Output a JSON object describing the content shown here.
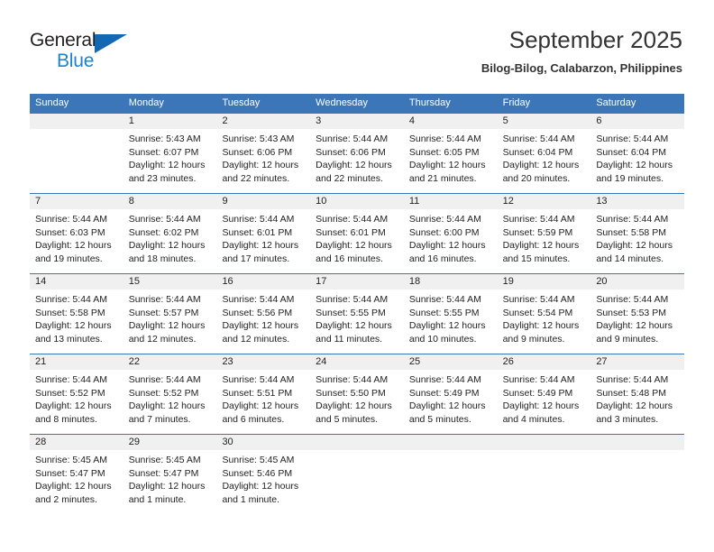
{
  "logo": {
    "word_one": "General",
    "word_two": "Blue",
    "triangle_color": "#1268b3",
    "blue_text_color": "#1c82d2"
  },
  "header": {
    "title": "September 2025",
    "subtitle": "Bilog-Bilog, Calabarzon, Philippines"
  },
  "theme": {
    "header_blue": "#3b76b8",
    "date_band": "#f0f0f0",
    "text": "#222222"
  },
  "weekdays": [
    "Sunday",
    "Monday",
    "Tuesday",
    "Wednesday",
    "Thursday",
    "Friday",
    "Saturday"
  ],
  "weeks": [
    [
      {
        "day": "",
        "sunrise": "",
        "sunset": "",
        "daylight_line1": "",
        "daylight_line2": ""
      },
      {
        "day": "1",
        "sunrise": "Sunrise: 5:43 AM",
        "sunset": "Sunset: 6:07 PM",
        "daylight_line1": "Daylight: 12 hours",
        "daylight_line2": "and 23 minutes."
      },
      {
        "day": "2",
        "sunrise": "Sunrise: 5:43 AM",
        "sunset": "Sunset: 6:06 PM",
        "daylight_line1": "Daylight: 12 hours",
        "daylight_line2": "and 22 minutes."
      },
      {
        "day": "3",
        "sunrise": "Sunrise: 5:44 AM",
        "sunset": "Sunset: 6:06 PM",
        "daylight_line1": "Daylight: 12 hours",
        "daylight_line2": "and 22 minutes."
      },
      {
        "day": "4",
        "sunrise": "Sunrise: 5:44 AM",
        "sunset": "Sunset: 6:05 PM",
        "daylight_line1": "Daylight: 12 hours",
        "daylight_line2": "and 21 minutes."
      },
      {
        "day": "5",
        "sunrise": "Sunrise: 5:44 AM",
        "sunset": "Sunset: 6:04 PM",
        "daylight_line1": "Daylight: 12 hours",
        "daylight_line2": "and 20 minutes."
      },
      {
        "day": "6",
        "sunrise": "Sunrise: 5:44 AM",
        "sunset": "Sunset: 6:04 PM",
        "daylight_line1": "Daylight: 12 hours",
        "daylight_line2": "and 19 minutes."
      }
    ],
    [
      {
        "day": "7",
        "sunrise": "Sunrise: 5:44 AM",
        "sunset": "Sunset: 6:03 PM",
        "daylight_line1": "Daylight: 12 hours",
        "daylight_line2": "and 19 minutes."
      },
      {
        "day": "8",
        "sunrise": "Sunrise: 5:44 AM",
        "sunset": "Sunset: 6:02 PM",
        "daylight_line1": "Daylight: 12 hours",
        "daylight_line2": "and 18 minutes."
      },
      {
        "day": "9",
        "sunrise": "Sunrise: 5:44 AM",
        "sunset": "Sunset: 6:01 PM",
        "daylight_line1": "Daylight: 12 hours",
        "daylight_line2": "and 17 minutes."
      },
      {
        "day": "10",
        "sunrise": "Sunrise: 5:44 AM",
        "sunset": "Sunset: 6:01 PM",
        "daylight_line1": "Daylight: 12 hours",
        "daylight_line2": "and 16 minutes."
      },
      {
        "day": "11",
        "sunrise": "Sunrise: 5:44 AM",
        "sunset": "Sunset: 6:00 PM",
        "daylight_line1": "Daylight: 12 hours",
        "daylight_line2": "and 16 minutes."
      },
      {
        "day": "12",
        "sunrise": "Sunrise: 5:44 AM",
        "sunset": "Sunset: 5:59 PM",
        "daylight_line1": "Daylight: 12 hours",
        "daylight_line2": "and 15 minutes."
      },
      {
        "day": "13",
        "sunrise": "Sunrise: 5:44 AM",
        "sunset": "Sunset: 5:58 PM",
        "daylight_line1": "Daylight: 12 hours",
        "daylight_line2": "and 14 minutes."
      }
    ],
    [
      {
        "day": "14",
        "sunrise": "Sunrise: 5:44 AM",
        "sunset": "Sunset: 5:58 PM",
        "daylight_line1": "Daylight: 12 hours",
        "daylight_line2": "and 13 minutes."
      },
      {
        "day": "15",
        "sunrise": "Sunrise: 5:44 AM",
        "sunset": "Sunset: 5:57 PM",
        "daylight_line1": "Daylight: 12 hours",
        "daylight_line2": "and 12 minutes."
      },
      {
        "day": "16",
        "sunrise": "Sunrise: 5:44 AM",
        "sunset": "Sunset: 5:56 PM",
        "daylight_line1": "Daylight: 12 hours",
        "daylight_line2": "and 12 minutes."
      },
      {
        "day": "17",
        "sunrise": "Sunrise: 5:44 AM",
        "sunset": "Sunset: 5:55 PM",
        "daylight_line1": "Daylight: 12 hours",
        "daylight_line2": "and 11 minutes."
      },
      {
        "day": "18",
        "sunrise": "Sunrise: 5:44 AM",
        "sunset": "Sunset: 5:55 PM",
        "daylight_line1": "Daylight: 12 hours",
        "daylight_line2": "and 10 minutes."
      },
      {
        "day": "19",
        "sunrise": "Sunrise: 5:44 AM",
        "sunset": "Sunset: 5:54 PM",
        "daylight_line1": "Daylight: 12 hours",
        "daylight_line2": "and 9 minutes."
      },
      {
        "day": "20",
        "sunrise": "Sunrise: 5:44 AM",
        "sunset": "Sunset: 5:53 PM",
        "daylight_line1": "Daylight: 12 hours",
        "daylight_line2": "and 9 minutes."
      }
    ],
    [
      {
        "day": "21",
        "sunrise": "Sunrise: 5:44 AM",
        "sunset": "Sunset: 5:52 PM",
        "daylight_line1": "Daylight: 12 hours",
        "daylight_line2": "and 8 minutes."
      },
      {
        "day": "22",
        "sunrise": "Sunrise: 5:44 AM",
        "sunset": "Sunset: 5:52 PM",
        "daylight_line1": "Daylight: 12 hours",
        "daylight_line2": "and 7 minutes."
      },
      {
        "day": "23",
        "sunrise": "Sunrise: 5:44 AM",
        "sunset": "Sunset: 5:51 PM",
        "daylight_line1": "Daylight: 12 hours",
        "daylight_line2": "and 6 minutes."
      },
      {
        "day": "24",
        "sunrise": "Sunrise: 5:44 AM",
        "sunset": "Sunset: 5:50 PM",
        "daylight_line1": "Daylight: 12 hours",
        "daylight_line2": "and 5 minutes."
      },
      {
        "day": "25",
        "sunrise": "Sunrise: 5:44 AM",
        "sunset": "Sunset: 5:49 PM",
        "daylight_line1": "Daylight: 12 hours",
        "daylight_line2": "and 5 minutes."
      },
      {
        "day": "26",
        "sunrise": "Sunrise: 5:44 AM",
        "sunset": "Sunset: 5:49 PM",
        "daylight_line1": "Daylight: 12 hours",
        "daylight_line2": "and 4 minutes."
      },
      {
        "day": "27",
        "sunrise": "Sunrise: 5:44 AM",
        "sunset": "Sunset: 5:48 PM",
        "daylight_line1": "Daylight: 12 hours",
        "daylight_line2": "and 3 minutes."
      }
    ],
    [
      {
        "day": "28",
        "sunrise": "Sunrise: 5:45 AM",
        "sunset": "Sunset: 5:47 PM",
        "daylight_line1": "Daylight: 12 hours",
        "daylight_line2": "and 2 minutes."
      },
      {
        "day": "29",
        "sunrise": "Sunrise: 5:45 AM",
        "sunset": "Sunset: 5:47 PM",
        "daylight_line1": "Daylight: 12 hours",
        "daylight_line2": "and 1 minute."
      },
      {
        "day": "30",
        "sunrise": "Sunrise: 5:45 AM",
        "sunset": "Sunset: 5:46 PM",
        "daylight_line1": "Daylight: 12 hours",
        "daylight_line2": "and 1 minute."
      },
      {
        "day": "",
        "sunrise": "",
        "sunset": "",
        "daylight_line1": "",
        "daylight_line2": ""
      },
      {
        "day": "",
        "sunrise": "",
        "sunset": "",
        "daylight_line1": "",
        "daylight_line2": ""
      },
      {
        "day": "",
        "sunrise": "",
        "sunset": "",
        "daylight_line1": "",
        "daylight_line2": ""
      },
      {
        "day": "",
        "sunrise": "",
        "sunset": "",
        "daylight_line1": "",
        "daylight_line2": ""
      }
    ]
  ]
}
